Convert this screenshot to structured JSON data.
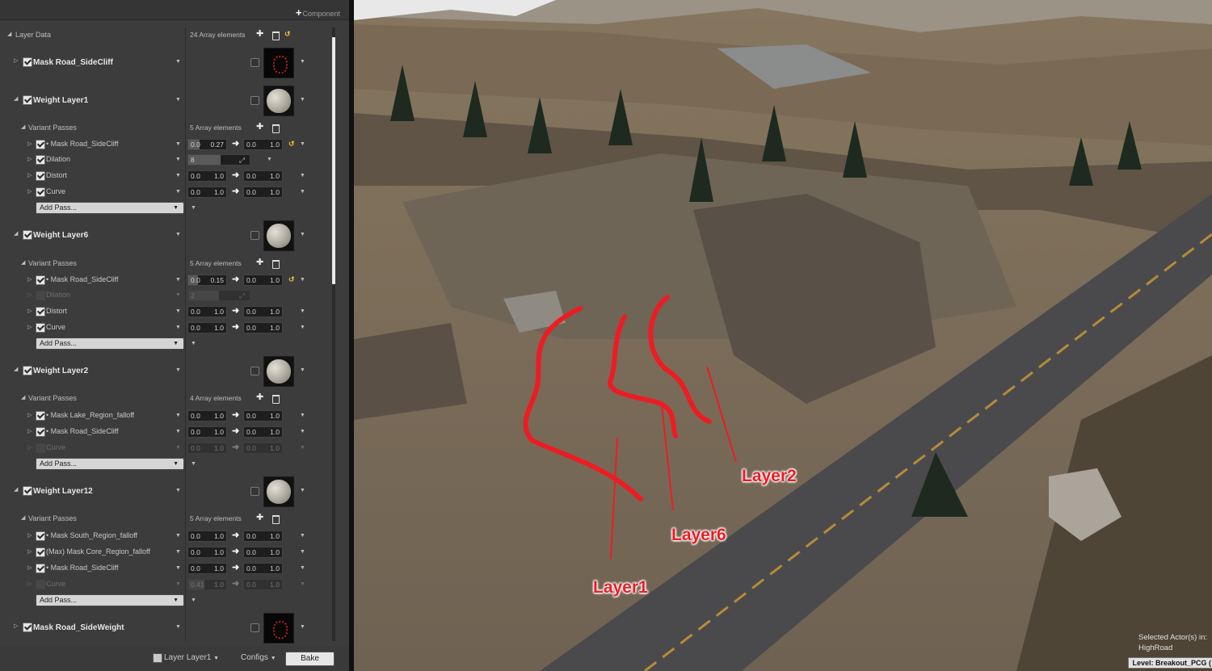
{
  "panel": {
    "component_label": "Component",
    "layer_data_label": "Layer Data",
    "layer_data_count": "24 Array elements",
    "variant_passes_label": "Variant Passes",
    "add_pass_label": "Add Pass..."
  },
  "layers": {
    "mask_road_sidecliff": "Mask Road_SideCliff",
    "weight_layer1": "Weight Layer1",
    "weight_layer6": "Weight Layer6",
    "weight_layer2": "Weight Layer2",
    "weight_layer12": "Weight Layer12",
    "mask_road_sideweight": "Mask Road_SideWeight"
  },
  "layer1": {
    "count": "5 Array elements",
    "passes": [
      {
        "name": "• Mask Road_SideCliff",
        "a1": "0.0",
        "b1": "0.27",
        "a2": "0.0",
        "b2": "1.0"
      },
      {
        "name": "Dilation",
        "value": "8"
      },
      {
        "name": "Distort",
        "a1": "0.0",
        "b1": "1.0",
        "a2": "0.0",
        "b2": "1.0"
      },
      {
        "name": "Curve",
        "a1": "0.0",
        "b1": "1.0",
        "a2": "0.0",
        "b2": "1.0"
      }
    ]
  },
  "layer6": {
    "count": "5 Array elements",
    "passes": [
      {
        "name": "• Mask Road_SideCliff",
        "a1": "0.0",
        "b1": "0.15",
        "a2": "0.0",
        "b2": "1.0"
      },
      {
        "name": "Dilation",
        "value": "2"
      },
      {
        "name": "Distort",
        "a1": "0.0",
        "b1": "1.0",
        "a2": "0.0",
        "b2": "1.0"
      },
      {
        "name": "Curve",
        "a1": "0.0",
        "b1": "1.0",
        "a2": "0.0",
        "b2": "1.0"
      }
    ]
  },
  "layer2": {
    "count": "4 Array elements",
    "passes": [
      {
        "name": "• Mask Lake_Region_falloff",
        "a1": "0.0",
        "b1": "1.0",
        "a2": "0.0",
        "b2": "1.0"
      },
      {
        "name": "• Mask Road_SideCliff",
        "a1": "0.0",
        "b1": "1.0",
        "a2": "0.0",
        "b2": "1.0"
      },
      {
        "name": "Curve",
        "a1": "0.0",
        "b1": "1.0",
        "a2": "0.0",
        "b2": "1.0"
      }
    ]
  },
  "layer12": {
    "count": "5 Array elements",
    "passes": [
      {
        "name": "• Mask South_Region_falloff",
        "a1": "0.0",
        "b1": "1.0",
        "a2": "0.0",
        "b2": "1.0"
      },
      {
        "name": "(Max) Mask Core_Region_falloff",
        "a1": "0.0",
        "b1": "1.0",
        "a2": "0.0",
        "b2": "1.0"
      },
      {
        "name": "• Mask Road_SideCliff",
        "a1": "0.0",
        "b1": "1.0",
        "a2": "0.0",
        "b2": "1.0"
      },
      {
        "name": "Curve",
        "a1": "0.41",
        "b1": "1.0",
        "a2": "0.0",
        "b2": "1.0"
      }
    ]
  },
  "bottom": {
    "layer_label": "Layer Layer1",
    "configs": "Configs",
    "bake": "Bake"
  },
  "viewport": {
    "annotations": [
      "Layer2",
      "Layer6",
      "Layer1"
    ],
    "selected_actors": "Selected Actor(s) in:",
    "selected_name": "HighRoad",
    "level": "Level:  Breakout_PCG ("
  },
  "colors": {
    "annotation": "#ed1c24",
    "panel_bg": "#3c3c3c",
    "checkbox": "#e6e6e6"
  }
}
